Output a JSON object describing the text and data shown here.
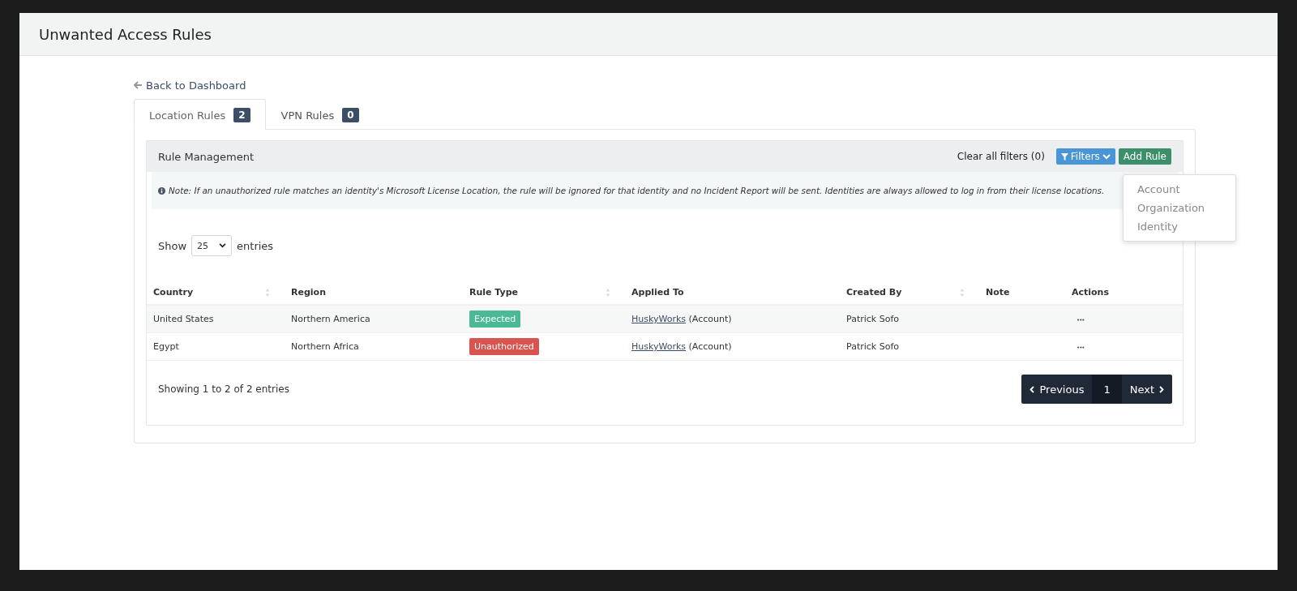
{
  "header": {
    "title": "Unwanted Access Rules"
  },
  "back_link": "Back to Dashboard",
  "tabs": [
    {
      "label": "Location Rules",
      "count": "2",
      "selected": true
    },
    {
      "label": "VPN Rules",
      "count": "0",
      "selected": false
    }
  ],
  "panel": {
    "title": "Rule Management",
    "clear_filters": "Clear all filters (0)",
    "filters_button": "Filters",
    "add_button": "Add Rule",
    "filter_menu": [
      "Account",
      "Organization",
      "Identity"
    ],
    "note": "*Note: If an unauthorized rule matches an identity's Microsoft License Location, the rule will be ignored for that identity and no Incident Report will be sent. Identities are always allowed to log in from their license locations.*"
  },
  "length": {
    "before": "Show",
    "value": "25",
    "after": "entries"
  },
  "table": {
    "columns": [
      {
        "label": "Country",
        "sortable": true
      },
      {
        "label": "Region",
        "sortable": false
      },
      {
        "label": "Rule Type",
        "sortable": true
      },
      {
        "label": "Applied To",
        "sortable": false
      },
      {
        "label": "Created By",
        "sortable": true
      },
      {
        "label": "Note",
        "sortable": false
      },
      {
        "label": "Actions",
        "sortable": false
      }
    ],
    "rows": [
      {
        "country": "United States",
        "region": "Northern America",
        "rule_type": {
          "label": "Expected",
          "kind": "expected"
        },
        "applied_link": "HuskyWorks",
        "applied_suffix": "(Account)",
        "created_by": "Patrick Sofo",
        "actions": "•••"
      },
      {
        "country": "Egypt",
        "region": "Northern Africa",
        "rule_type": {
          "label": "Unauthorized",
          "kind": "unauthorized"
        },
        "applied_link": "HuskyWorks",
        "applied_suffix": "(Account)",
        "created_by": "Patrick Sofo",
        "actions": "•••"
      }
    ]
  },
  "info": "Showing 1 to 2 of 2 entries",
  "pagination": {
    "previous": "Previous",
    "next": "Next",
    "pages": [
      {
        "label": "1",
        "selected": true
      }
    ]
  }
}
